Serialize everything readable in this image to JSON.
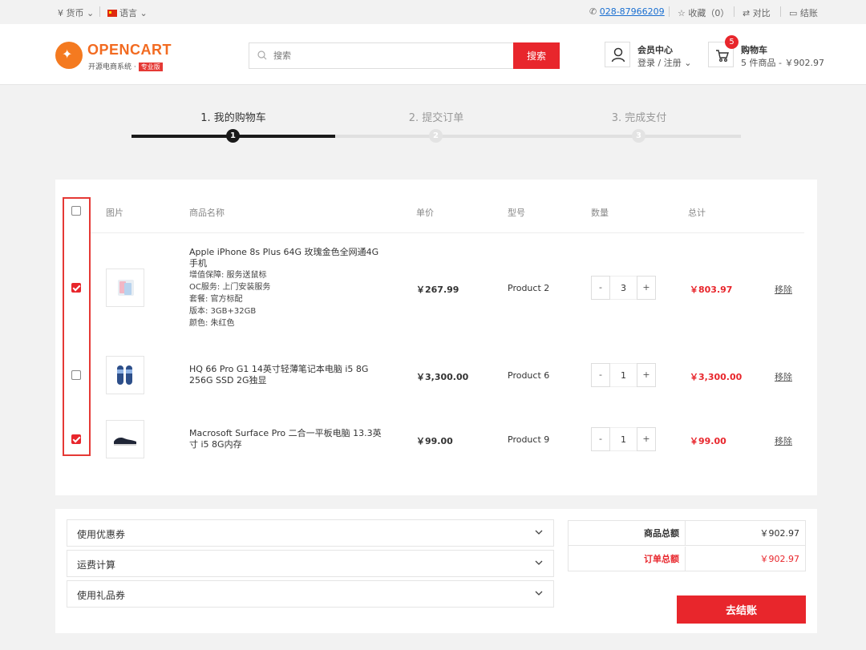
{
  "topbar": {
    "currency": "¥ 货币",
    "language": "语言",
    "phone": "028-87966209",
    "favorites": "收藏（0）",
    "compare": "对比",
    "checkout": "结账"
  },
  "header": {
    "logo_name": "OPENCART",
    "logo_sub": "开源电商系统 ·",
    "logo_badge": "专业版",
    "search_placeholder": "搜索",
    "search_button": "搜索",
    "member_title": "会员中心",
    "member_sub": "登录 / 注册",
    "cart_title": "购物车",
    "cart_count": "5",
    "cart_sub": "5 件商品 - ￥902.97"
  },
  "steps": [
    {
      "label": "1. 我的购物车",
      "num": "1"
    },
    {
      "label": "2. 提交订单",
      "num": "2"
    },
    {
      "label": "3. 完成支付",
      "num": "3"
    }
  ],
  "table": {
    "headers": {
      "image": "图片",
      "name": "商品名称",
      "price": "单价",
      "model": "型号",
      "qty": "数量",
      "total": "总计"
    },
    "select_all_checked": false,
    "rows": [
      {
        "checked": true,
        "name": "Apple iPhone 8s Plus 64G 玫瑰金色全网通4G手机",
        "options": [
          "增值保障: 服务送鼠标",
          "OC服务: 上门安装服务",
          "套餐: 官方标配",
          "版本: 3GB+32GB",
          "颜色: 朱红色"
        ],
        "price": "￥267.99",
        "model": "Product 2",
        "qty": "3",
        "total": "￥803.97",
        "remove": "移除",
        "image_icon": "phone-product-icon"
      },
      {
        "checked": false,
        "name": "HQ 66 Pro G1 14英寸轻薄笔记本电脑 i5 8G 256G SSD 2G独显",
        "options": [],
        "price": "￥3,300.00",
        "model": "Product 6",
        "qty": "1",
        "total": "￥3,300.00",
        "remove": "移除",
        "image_icon": "slippers-product-icon"
      },
      {
        "checked": true,
        "name": "Macrosoft Surface Pro 二合一平板电脑 13.3英寸 i5 8G内存",
        "options": [],
        "price": "￥99.00",
        "model": "Product 9",
        "qty": "1",
        "total": "￥99.00",
        "remove": "移除",
        "image_icon": "shoe-product-icon"
      }
    ]
  },
  "accordions": [
    "使用优惠券",
    "运费计算",
    "使用礼品券"
  ],
  "summary": {
    "subtotal_label": "商品总额",
    "subtotal_value": "￥902.97",
    "order_total_label": "订单总额",
    "order_total_value": "￥902.97"
  },
  "checkout_button": "去结账",
  "colors": {
    "accent": "#e8262c",
    "brand": "#f26b21"
  }
}
